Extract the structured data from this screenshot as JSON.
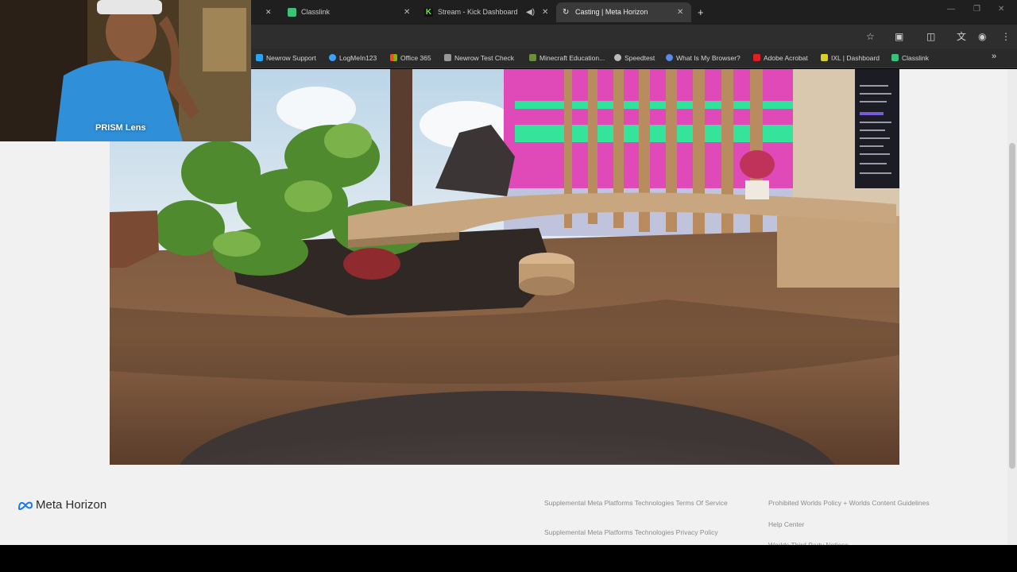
{
  "browser": {
    "tabs": [
      {
        "title": "Classlink",
        "active": false
      },
      {
        "title": "Stream - Kick Dashboard",
        "active": false
      },
      {
        "title": "Casting | Meta Horizon",
        "active": true
      }
    ],
    "new_tab": "+",
    "bookmarks": [
      {
        "label": "Newrow Support",
        "color": "#2aa3f0"
      },
      {
        "label": "LogMeIn123",
        "color": "#3ba3ff"
      },
      {
        "label": "Office 365",
        "color": "#e8641b"
      },
      {
        "label": "Newrow Test Check",
        "color": "#999999"
      },
      {
        "label": "Minecraft Education...",
        "color": "#6b8e3d"
      },
      {
        "label": "Speedtest",
        "color": "#bbbbbb"
      },
      {
        "label": "What Is My Browser?",
        "color": "#5a8ae8"
      },
      {
        "label": "Adobe Acrobat",
        "color": "#e02020"
      },
      {
        "label": "IXL | Dashboard",
        "color": "#d8d02a"
      },
      {
        "label": "Classlink",
        "color": "#3cc17a"
      }
    ],
    "more_bookmarks": "»"
  },
  "webcam": {
    "caption": "PRISM Lens"
  },
  "footer": {
    "brand": "Meta Horizon",
    "links": [
      "Supplemental Meta Platforms Technologies Terms Of Service",
      "Supplemental Meta Platforms Technologies Privacy Policy",
      "Prohibited Worlds Policy + Worlds Content Guidelines",
      "Help Center",
      "Worlds Third Party Notices"
    ]
  }
}
